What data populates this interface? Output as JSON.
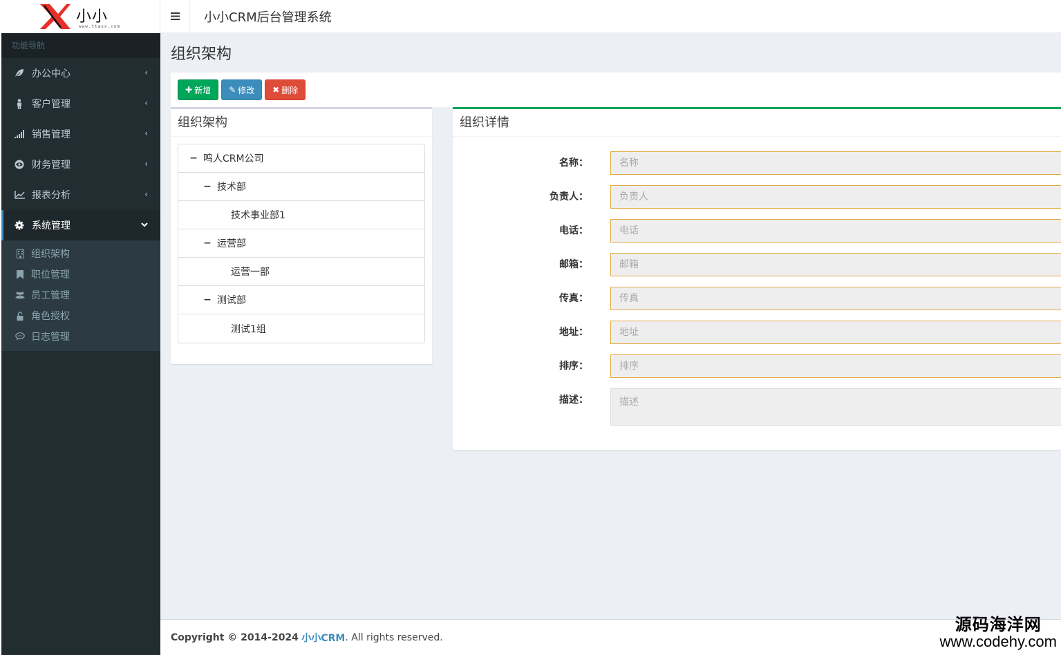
{
  "brand": {
    "name": "小小",
    "url": "www.ttaxx.com"
  },
  "sidebar": {
    "header": "功能导航",
    "items": [
      {
        "label": "办公中心",
        "icon": "leaf-icon"
      },
      {
        "label": "客户管理",
        "icon": "person-icon"
      },
      {
        "label": "销售管理",
        "icon": "signal-icon"
      },
      {
        "label": "财务管理",
        "icon": "eye-icon"
      },
      {
        "label": "报表分析",
        "icon": "line-chart-icon"
      },
      {
        "label": "系统管理",
        "icon": "gear-icon"
      }
    ],
    "subitems": [
      {
        "label": "组织架构",
        "icon": "building-icon"
      },
      {
        "label": "职位管理",
        "icon": "bookmark-icon"
      },
      {
        "label": "员工管理",
        "icon": "users-icon"
      },
      {
        "label": "角色授权",
        "icon": "unlock-icon"
      },
      {
        "label": "日志管理",
        "icon": "comment-icon"
      }
    ]
  },
  "topbar": {
    "title": "小小CRM后台管理系统"
  },
  "page": {
    "title": "组织架构"
  },
  "toolbar": {
    "add_label": "新增",
    "edit_label": "修改",
    "delete_label": "删除"
  },
  "tree_panel": {
    "title": "组织架构",
    "nodes": [
      {
        "label": "鸣人CRM公司",
        "level": 0,
        "toggle": "minus"
      },
      {
        "label": "技术部",
        "level": 1,
        "toggle": "minus"
      },
      {
        "label": "技术事业部1",
        "level": 2,
        "toggle": ""
      },
      {
        "label": "运营部",
        "level": 1,
        "toggle": "minus"
      },
      {
        "label": "运营一部",
        "level": 2,
        "toggle": ""
      },
      {
        "label": "测试部",
        "level": 1,
        "toggle": "minus"
      },
      {
        "label": "测试1组",
        "level": 2,
        "toggle": ""
      }
    ]
  },
  "detail_panel": {
    "title": "组织详情",
    "fields": [
      {
        "label": "名称：",
        "placeholder": "名称",
        "value": ""
      },
      {
        "label": "负责人：",
        "placeholder": "负责人",
        "value": ""
      },
      {
        "label": "电话：",
        "placeholder": "电话",
        "value": ""
      },
      {
        "label": "邮箱：",
        "placeholder": "邮箱",
        "value": ""
      },
      {
        "label": "传真：",
        "placeholder": "传真",
        "value": ""
      },
      {
        "label": "地址：",
        "placeholder": "地址",
        "value": ""
      },
      {
        "label": "排序：",
        "placeholder": "排序",
        "value": ""
      },
      {
        "label": "描述：",
        "placeholder": "描述",
        "value": ""
      }
    ]
  },
  "footer": {
    "prefix": "Copyright © 2014-2024",
    "link": "小小CRM",
    "suffix": ". All rights reserved."
  },
  "watermark": {
    "line1": "源码海洋网",
    "line2": "www.codehy.com"
  },
  "colors": {
    "sidebar_bg": "#222d32",
    "accent": "#3c8dbc",
    "success": "#00a65a",
    "danger": "#dd4b39",
    "input_border": "#e5a942"
  }
}
